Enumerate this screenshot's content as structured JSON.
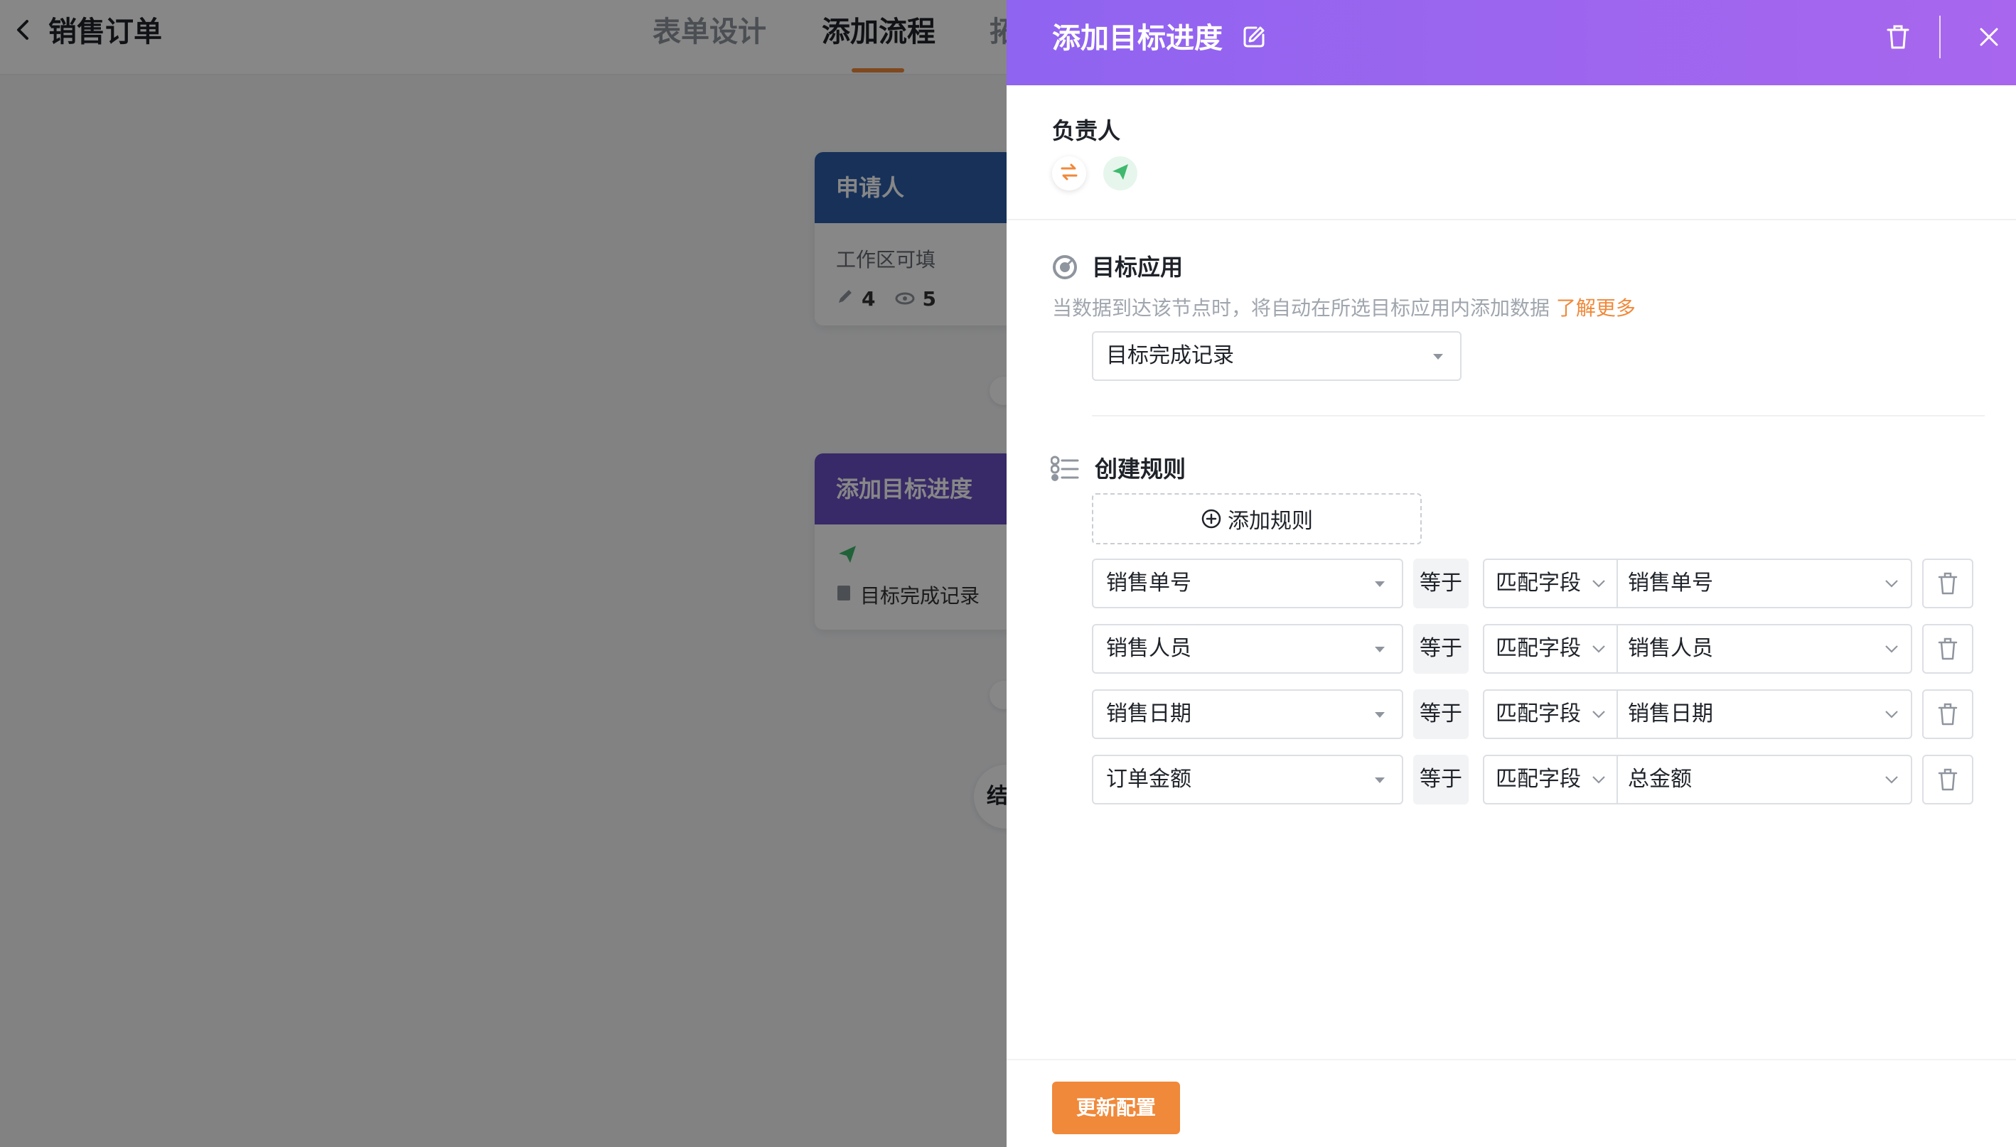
{
  "app": {
    "title": "销售订单"
  },
  "tabs": [
    {
      "label": "表单设计"
    },
    {
      "label": "添加流程"
    },
    {
      "label": "拓"
    }
  ],
  "flow": {
    "applicant_card": {
      "title": "申请人",
      "subtitle": "工作区可填",
      "edit_count": "4",
      "view_count": "5",
      "color": "#2c5ea8"
    },
    "target_card": {
      "title": "添加目标进度",
      "record": "目标完成记录",
      "color": "#6a4fc4"
    },
    "end_node": {
      "label": "结"
    }
  },
  "drawer": {
    "title": "添加目标进度",
    "owner": {
      "label": "负责人"
    },
    "target_app": {
      "label": "目标应用",
      "hint": "当数据到达该节点时，将自动在所选目标应用内添加数据",
      "hint_link": "了解更多",
      "selected": "目标完成记录"
    },
    "rules": {
      "label": "创建规则",
      "add_label": "添加规则",
      "items": [
        {
          "field": "销售单号",
          "op": "等于",
          "mode": "匹配字段",
          "target": "销售单号"
        },
        {
          "field": "销售人员",
          "op": "等于",
          "mode": "匹配字段",
          "target": "销售人员"
        },
        {
          "field": "销售日期",
          "op": "等于",
          "mode": "匹配字段",
          "target": "销售日期"
        },
        {
          "field": "订单金额",
          "op": "等于",
          "mode": "匹配字段",
          "target": "总金额"
        }
      ]
    },
    "submit_label": "更新配置"
  },
  "colors": {
    "accent": "#f0893a",
    "header_start": "#8f64f0",
    "header_end": "#a866ee",
    "send_green": "#3fb96d"
  }
}
